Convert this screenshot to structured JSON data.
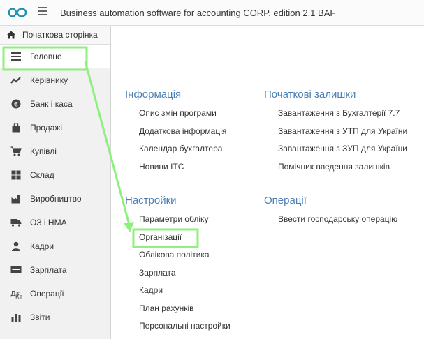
{
  "header": {
    "app_title": "Business automation software for accounting CORP, edition 2.1 BAF"
  },
  "sidebar": {
    "home_label": "Початкова сторінка",
    "items": [
      {
        "label": "Головне",
        "icon": "list-icon"
      },
      {
        "label": "Керівнику",
        "icon": "trend-icon"
      },
      {
        "label": "Банк і каса",
        "icon": "coin-icon"
      },
      {
        "label": "Продажі",
        "icon": "bag-icon"
      },
      {
        "label": "Купівлі",
        "icon": "cart-icon"
      },
      {
        "label": "Склад",
        "icon": "warehouse-icon"
      },
      {
        "label": "Виробництво",
        "icon": "factory-icon"
      },
      {
        "label": "ОЗ і НМА",
        "icon": "truck-icon"
      },
      {
        "label": "Кадри",
        "icon": "person-icon"
      },
      {
        "label": "Зарплата",
        "icon": "payroll-icon"
      },
      {
        "label": "Операції",
        "icon": "operations-icon"
      },
      {
        "label": "Звіти",
        "icon": "bar-chart-icon"
      }
    ]
  },
  "main": {
    "info": {
      "title": "Інформація",
      "links": [
        "Опис змін програми",
        "Додаткова інформація",
        "Календар бухгалтера",
        "Новини ITC"
      ]
    },
    "balances": {
      "title": "Початкові залишки",
      "links": [
        "Завантаження з Бухгалтерії 7.7",
        "Завантаження з УТП для України",
        "Завантаження з ЗУП для України",
        "Помічник введення залишків"
      ]
    },
    "settings": {
      "title": "Настройки",
      "links": [
        "Параметри обліку",
        "Організації",
        "Облікова політика",
        "Зарплата",
        "Кадри",
        "План рахунків",
        "Персональні настройки"
      ]
    },
    "operations": {
      "title": "Операції",
      "links": [
        "Ввести господарську операцію"
      ]
    }
  },
  "colors": {
    "section_title": "#4a7fb5",
    "annotation": "#8ef07e"
  }
}
